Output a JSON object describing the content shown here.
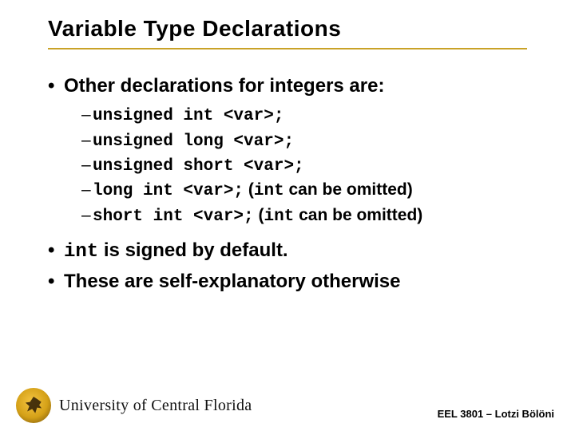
{
  "title": "Variable Type Declarations",
  "bullet1": "Other declarations for integers are:",
  "sub": [
    {
      "code": "unsigned int <var>;",
      "note": ""
    },
    {
      "code": "unsigned long <var>;",
      "note": ""
    },
    {
      "code": "unsigned short <var>;",
      "note": ""
    },
    {
      "code": "long int <var>;",
      "note_prefix": " (",
      "note_code": "int",
      "note_suffix": " can be omitted)"
    },
    {
      "code": "short int <var>;",
      "note_prefix": " (",
      "note_code": "int",
      "note_suffix": " can be omitted)"
    }
  ],
  "bullet2": "int is signed by default.",
  "bullet3": "These are self-explanatory otherwise",
  "footer": "EEL 3801 – Lotzi Bölöni",
  "university": "University of Central Florida"
}
